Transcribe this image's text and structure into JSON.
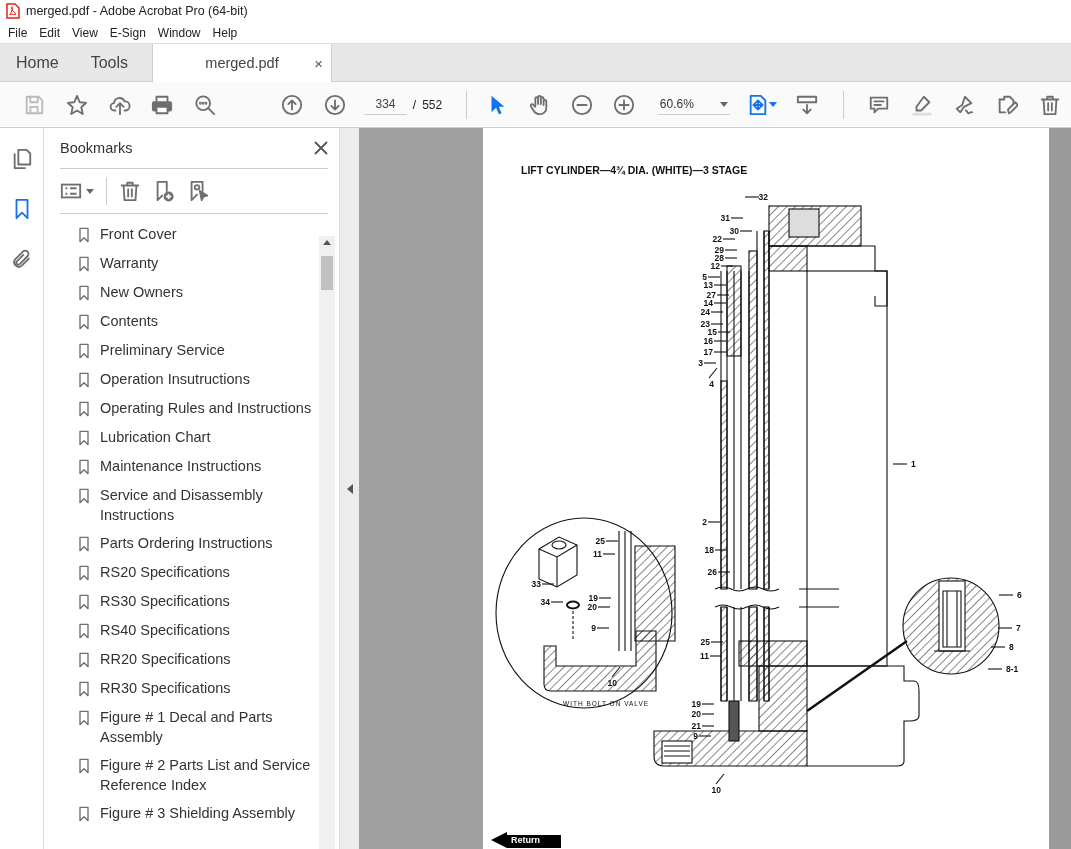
{
  "window": {
    "title": "merged.pdf - Adobe Acrobat Pro (64-bit)"
  },
  "menu": [
    "File",
    "Edit",
    "View",
    "E-Sign",
    "Window",
    "Help"
  ],
  "tabs": [
    {
      "label": "Home",
      "selected": false
    },
    {
      "label": "Tools",
      "selected": false
    },
    {
      "label": "merged.pdf",
      "selected": true,
      "close": "×"
    }
  ],
  "toolbar": {
    "save_disabled": true,
    "page_current": "334",
    "page_separator": "/",
    "page_total": "552",
    "zoom": "60.6%",
    "tools": [
      {
        "kind": "select",
        "selected": true
      },
      {
        "kind": "hand",
        "selected": false
      }
    ]
  },
  "rail": [
    {
      "kind": "pages",
      "selected": false
    },
    {
      "kind": "bookmarks",
      "selected": true
    },
    {
      "kind": "attachments",
      "selected": false
    }
  ],
  "bookmarks": {
    "title": "Bookmarks",
    "items": [
      "Front Cover",
      "Warranty",
      "New Owners",
      "Contents",
      "Preliminary Service",
      "Operation Insutructions",
      "Operating Rules and Instructions",
      "Lubrication Chart",
      "Maintenance Instructions",
      "Service and Disassembly Instructions",
      "Parts Ordering Instructions",
      "RS20 Specifications",
      "RS30 Specifications",
      "RS40 Specifications",
      "RR20 Specifications",
      "RR30 Specifications",
      "Figure # 1 Decal and Parts Assembly",
      "Figure # 2 Parts List and Service Reference Index",
      "Figure # 3 Shielding Assembly"
    ]
  },
  "document": {
    "title": "LIFT CYLINDER—4¾ DIA. (WHITE)—3 STAGE",
    "callouts": [
      "32",
      "31",
      "30",
      "22",
      "29",
      "28",
      "12",
      "5",
      "13",
      "27",
      "14",
      "24",
      "23",
      "15",
      "16",
      "17",
      "3",
      "4",
      "1",
      "2",
      "18",
      "26",
      "25",
      "11",
      "19",
      "20",
      "21",
      "9",
      "10",
      "25",
      "11",
      "33",
      "34",
      "19",
      "20",
      "9",
      "10",
      "6",
      "7",
      "8",
      "8-1"
    ],
    "caption": "WITH BOLT ON VALVE",
    "return": "Return"
  }
}
